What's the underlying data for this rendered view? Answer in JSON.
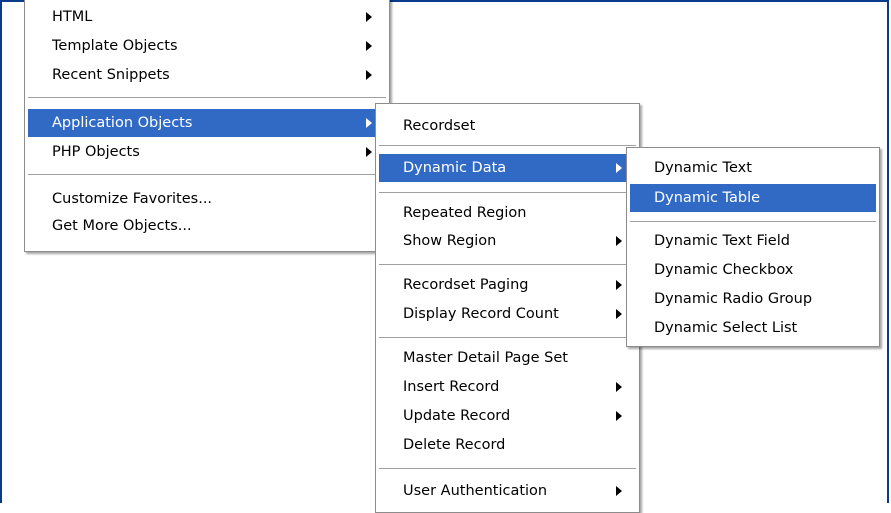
{
  "main_menu": {
    "items": [
      {
        "label": "HTML"
      },
      {
        "label": "Template Objects"
      },
      {
        "label": "Recent Snippets"
      },
      {
        "label": "Application Objects"
      },
      {
        "label": "PHP Objects"
      },
      {
        "label": "Customize Favorites..."
      },
      {
        "label": "Get More Objects..."
      }
    ]
  },
  "application_objects_menu": {
    "items": [
      {
        "label": "Recordset"
      },
      {
        "label": "Dynamic Data"
      },
      {
        "label": "Repeated Region"
      },
      {
        "label": "Show Region"
      },
      {
        "label": "Recordset Paging"
      },
      {
        "label": "Display Record Count"
      },
      {
        "label": "Master Detail Page Set"
      },
      {
        "label": "Insert Record"
      },
      {
        "label": "Update Record"
      },
      {
        "label": "Delete Record"
      },
      {
        "label": "User Authentication"
      }
    ]
  },
  "dynamic_data_menu": {
    "items": [
      {
        "label": "Dynamic Text"
      },
      {
        "label": "Dynamic Table"
      },
      {
        "label": "Dynamic Text Field"
      },
      {
        "label": "Dynamic Checkbox"
      },
      {
        "label": "Dynamic Radio Group"
      },
      {
        "label": "Dynamic Select List"
      }
    ]
  },
  "colors": {
    "selection": "#316ac5",
    "frame_border": "#0a3a8c"
  },
  "icons": {
    "submenu_arrow": "chevron-right-icon"
  }
}
